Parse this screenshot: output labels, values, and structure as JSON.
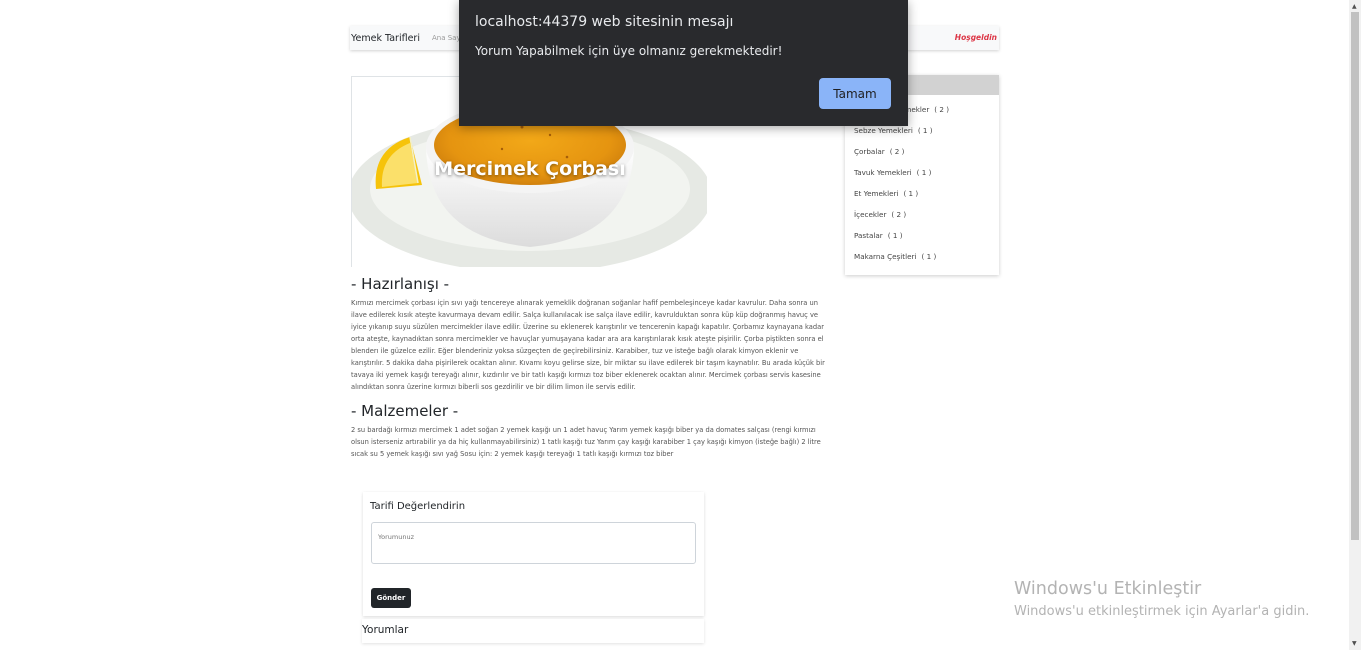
{
  "navbar": {
    "brand": "Yemek Tarifleri",
    "home_link": "Ana Sayfa",
    "welcome": "Hoşgeldin"
  },
  "recipe": {
    "title": "Mercimek Çorbası",
    "preparation_heading": "- Hazırlanışı -",
    "preparation_text": "Kırmızı mercimek çorbası için sıvı yağı tencereye alınarak yemeklik doğranan soğanlar hafif pembeleşinceye kadar kavrulur. Daha sonra un ilave edilerek kısık ateşte kavurmaya devam edilir. Salça kullanılacak ise salça ilave edilir, kavrulduktan sonra küp küp doğranmış havuç ve iyice yıkanıp suyu süzülen mercimekler ilave edilir. Üzerine su eklenerek karıştırılır ve tencerenin kapağı kapatılır. Çorbamız kaynayana kadar orta ateşte, kaynadıktan sonra mercimekler ve havuçlar yumuşayana kadar ara ara karıştırılarak kısık ateşte pişirilir. Çorba piştikten sonra el blenderı ile güzelce ezilir. Eğer blenderiniz yoksa süzgeçten de geçirebilirsiniz. Karabiber, tuz ve isteğe bağlı olarak kimyon eklenir ve karıştırılır. 5 dakika daha pişirilerek ocaktan alınır. Kıvamı koyu gelirse size, bir miktar su ilave edilerek bir taşım kaynatılır. Bu arada küçük bir tavaya iki yemek kaşığı tereyağı alınır, kızdırılır ve bir tatlı kaşığı kırmızı toz biber eklenerek ocaktan alınır. Mercimek çorbası servis kasesine alındıktan sonra üzerine kırmızı biberli sos gezdirilir ve bir dilim limon ile servis edilir.",
    "ingredients_heading": "- Malzemeler -",
    "ingredients_text": "2 su bardağı kırmızı mercimek 1 adet soğan 2 yemek kaşığı un 1 adet havuç Yarım yemek kaşığı biber ya da domates salçası (rengi kırmızı olsun isterseniz artırabilir ya da hiç kullanmayabilirsiniz) 1 tatlı kaşığı tuz Yarım çay kaşığı karabiber 1 çay kaşığı kimyon (isteğe bağlı) 2 litre sıcak su 5 yemek kaşığı sıvı yağ Sosu için: 2 yemek kaşığı tereyağı 1 tatlı kaşığı kırmızı toz biber"
  },
  "sidebar": {
    "categories": [
      {
        "label": "Zeytinyağlı Yemekler",
        "count": "( 2 )"
      },
      {
        "label": "Sebze Yemekleri",
        "count": "( 1 )"
      },
      {
        "label": "Çorbalar",
        "count": "( 2 )"
      },
      {
        "label": "Tavuk Yemekleri",
        "count": "( 1 )"
      },
      {
        "label": "Et Yemekleri",
        "count": "( 1 )"
      },
      {
        "label": "İçecekler",
        "count": "( 2 )"
      },
      {
        "label": "Pastalar",
        "count": "( 1 )"
      },
      {
        "label": "Makarna Çeşitleri",
        "count": "( 1 )"
      }
    ]
  },
  "comment_form": {
    "title": "Tarifi Değerlendirin",
    "placeholder": "Yorumunuz",
    "submit_label": "Gönder"
  },
  "comments": {
    "heading": "Yorumlar"
  },
  "alert": {
    "title": "localhost:44379 web sitesinin mesajı",
    "message": "Yorum Yapabilmek için üye olmanız gerekmektedir!",
    "ok_label": "Tamam"
  },
  "watermark": {
    "title": "Windows'u Etkinleştir",
    "subtitle": "Windows'u etkinleştirmek için Ayarlar'a gidin."
  },
  "colors": {
    "welcome": "#dc3545",
    "alert_bg": "#292a2d",
    "alert_button": "#8ab4f8",
    "submit_button": "#212529"
  }
}
